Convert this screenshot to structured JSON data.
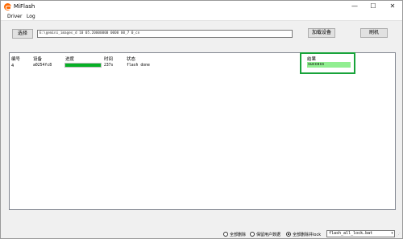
{
  "window": {
    "title": "MiFlash",
    "controls": {
      "minimize": "—",
      "maximize": "☐",
      "close": "✕"
    }
  },
  "menu": {
    "items": [
      "Driver",
      "Log"
    ]
  },
  "toolbar": {
    "select_label": "选择",
    "path_value": "E:\\gemini_images_d 10 05.20000000 0000 00_7 0_cn",
    "load_device_label": "加载设备",
    "flash_label": "刷机"
  },
  "table": {
    "headers": [
      "编号",
      "设备",
      "进度",
      "时间",
      "状态",
      "结果"
    ],
    "rows": [
      {
        "id": "4",
        "device": "a0254fc8",
        "progress": 1.0,
        "time": "237s",
        "status": "flash done",
        "result": "success"
      }
    ]
  },
  "bottom": {
    "radios": [
      {
        "label": "全部删除",
        "selected": false
      },
      {
        "label": "保留用户数据",
        "selected": false
      },
      {
        "label": "全部删除并lock",
        "selected": true
      }
    ],
    "script_select": "flash_all_lock.bat"
  },
  "colors": {
    "success_bg": "#90ee90",
    "progress_fill": "#06b025",
    "highlight_border": "#18a33a",
    "app_icon": "#ff6900"
  }
}
